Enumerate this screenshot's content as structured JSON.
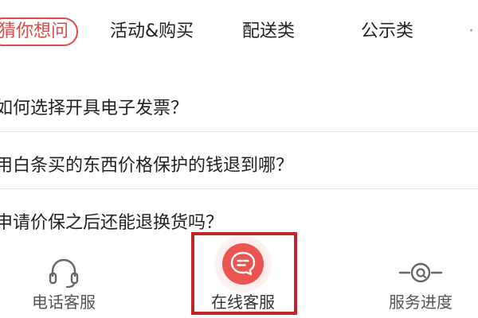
{
  "tabs": [
    {
      "label": "猜你想问",
      "active": true
    },
    {
      "label": "活动&购买",
      "active": false
    },
    {
      "label": "配送类",
      "active": false
    },
    {
      "label": "公示类",
      "active": false
    }
  ],
  "faq": [
    {
      "question": "如何选择开具电子发票？"
    },
    {
      "question": "用白条买的东西价格保护的钱退到哪？"
    },
    {
      "question": "申请价保之后还能退换货吗？"
    }
  ],
  "bottom_bar": {
    "phone_service": {
      "label": "电话客服",
      "icon": "headset-icon"
    },
    "online_service": {
      "label": "在线客服",
      "icon": "chat-bubble-icon"
    },
    "service_progress": {
      "label": "服务进度",
      "icon": "progress-icon"
    }
  },
  "colors": {
    "accent": "#e24a48",
    "highlight_frame": "#c4232a",
    "divider": "#e6e6e6"
  }
}
